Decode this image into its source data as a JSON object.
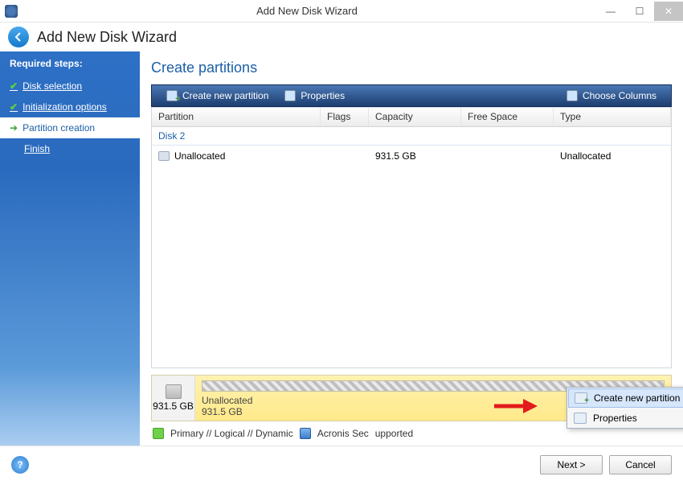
{
  "window": {
    "title": "Add New Disk Wizard"
  },
  "header": {
    "title": "Add New Disk Wizard"
  },
  "sidebar": {
    "heading": "Required steps:",
    "steps": [
      {
        "label": "Disk selection",
        "state": "done"
      },
      {
        "label": "Initialization options",
        "state": "done"
      },
      {
        "label": "Partition creation",
        "state": "active"
      },
      {
        "label": "Finish",
        "state": "pending"
      }
    ]
  },
  "content": {
    "title": "Create partitions",
    "toolbar": {
      "create": "Create new partition",
      "properties": "Properties",
      "columns": "Choose Columns"
    },
    "columns": {
      "partition": "Partition",
      "flags": "Flags",
      "capacity": "Capacity",
      "freespace": "Free Space",
      "type": "Type"
    },
    "group": "Disk 2",
    "rows": [
      {
        "partition": "Unallocated",
        "flags": "",
        "capacity": "931.5 GB",
        "freespace": "",
        "type": "Unallocated"
      }
    ],
    "diskmap": {
      "total": "931.5 GB",
      "label": "Unallocated",
      "size": "931.5 GB"
    },
    "context": {
      "create": "Create new partition",
      "properties": "Properties"
    },
    "legend": {
      "pld": "Primary // Logical // Dynamic",
      "acronis": "Acronis Sec",
      "supported": "upported"
    }
  },
  "footer": {
    "next": "Next >",
    "cancel": "Cancel"
  }
}
